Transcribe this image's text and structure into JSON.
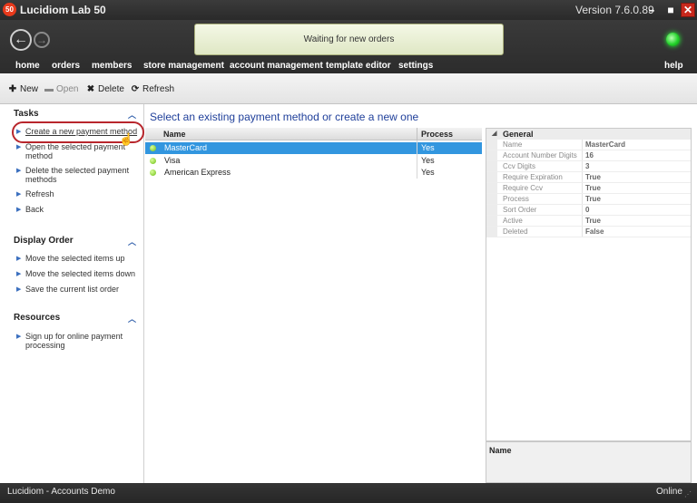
{
  "window": {
    "logo": "50",
    "title": "Lucidiom Lab 50",
    "version": "Version 7.6.0.89",
    "minimize_glyph": "–",
    "maximize_glyph": "■",
    "close_glyph": "✕"
  },
  "header": {
    "back_glyph": "←",
    "forward_glyph": "→",
    "status_message": "Waiting for new orders",
    "connection_light_color": "#22d22a"
  },
  "nav": {
    "items": [
      "home",
      "orders",
      "members",
      "store management",
      "account management",
      "template editor",
      "settings"
    ],
    "help": "help"
  },
  "toolbar": {
    "new_label": "New",
    "open_label": "Open",
    "delete_label": "Delete",
    "refresh_label": "Refresh",
    "new_icon": "plus-icon",
    "open_icon": "folder-icon",
    "delete_icon": "x-icon",
    "refresh_icon": "refresh-icon"
  },
  "sidebar": {
    "tasks": {
      "title": "Tasks",
      "links": [
        "Create a new payment method",
        "Open the selected payment method",
        "Delete the selected payment methods",
        "Refresh",
        "Back"
      ]
    },
    "display_order": {
      "title": "Display Order",
      "links": [
        "Move the selected items up",
        "Move the selected items down",
        "Save the current list order"
      ]
    },
    "resources": {
      "title": "Resources",
      "links": [
        "Sign up for online payment processing"
      ]
    }
  },
  "main": {
    "title": "Select an existing payment method or create a new one",
    "columns": [
      "Name",
      "Process"
    ],
    "rows": [
      {
        "name": "MasterCard",
        "process": "Yes",
        "selected": true
      },
      {
        "name": "Visa",
        "process": "Yes",
        "selected": false
      },
      {
        "name": "American Express",
        "process": "Yes",
        "selected": false
      }
    ]
  },
  "properties": {
    "category": "General",
    "rows": [
      {
        "name": "Name",
        "value": "MasterCard"
      },
      {
        "name": "Account Number Digits",
        "value": "16"
      },
      {
        "name": "Ccv Digits",
        "value": "3"
      },
      {
        "name": "Require Expiration",
        "value": "True"
      },
      {
        "name": "Require Ccv",
        "value": "True"
      },
      {
        "name": "Process",
        "value": "True"
      },
      {
        "name": "Sort Order",
        "value": "0"
      },
      {
        "name": "Active",
        "value": "True"
      },
      {
        "name": "Deleted",
        "value": "False"
      }
    ],
    "description_title": "Name"
  },
  "statusbar": {
    "left": "Lucidiom - Accounts Demo",
    "right": "Online"
  },
  "colors": {
    "selection": "#3296df",
    "title_blue": "#1f3f9a",
    "highlight_ring": "#b8262c"
  }
}
